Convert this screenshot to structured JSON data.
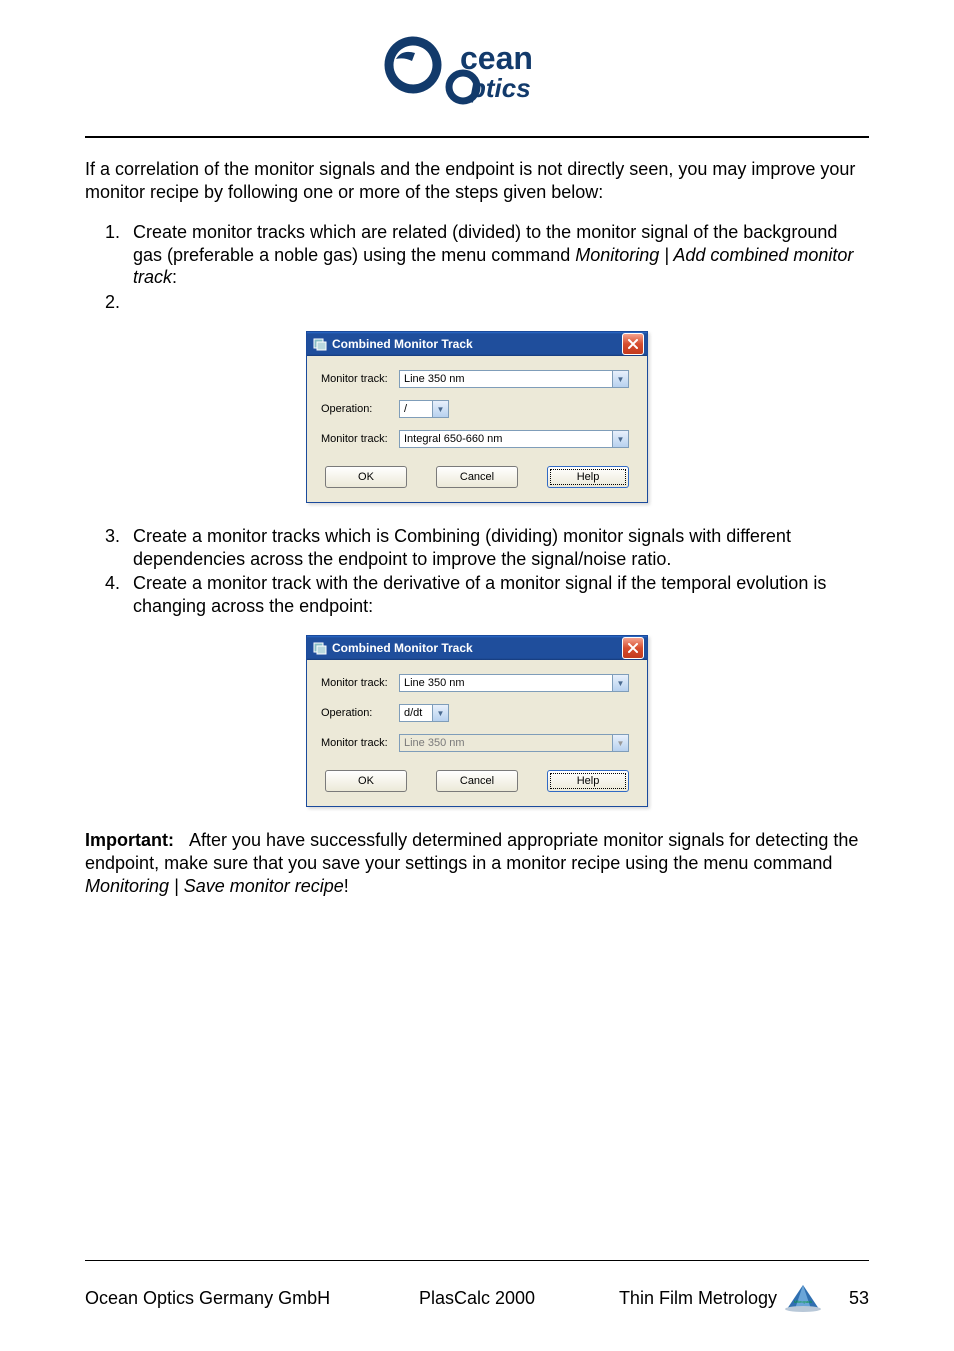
{
  "logo": {
    "top": "cean",
    "bottom": "ptics",
    "brand_blue": "#123a6b"
  },
  "para1": "If a correlation of the monitor signals and the endpoint is not directly seen, you may improve your monitor recipe by following one or more of the steps given below:",
  "list": {
    "item1_a": "Create monitor tracks which are related (divided) to the monitor signal of the background gas (preferable a noble gas) using the menu command ",
    "item1_b": "Monitoring | Add combined monitor track",
    "item1_c": ":",
    "item3": "Create a monitor tracks which is Combining (dividing) monitor signals with different dependencies across the endpoint to improve the signal/noise ratio.",
    "item4": "Create a monitor track with the derivative of a monitor signal if the temporal evolution is changing across the endpoint:"
  },
  "dialog1": {
    "title": "Combined Monitor Track",
    "labels": {
      "track1": "Monitor track:",
      "operation": "Operation:",
      "track2": "Monitor track:"
    },
    "values": {
      "track1": "Line 350 nm",
      "operation": "/",
      "track2": "Integral 650-660 nm"
    },
    "buttons": {
      "ok": "OK",
      "cancel": "Cancel",
      "help": "Help"
    }
  },
  "dialog2": {
    "title": "Combined Monitor Track",
    "labels": {
      "track1": "Monitor track:",
      "operation": "Operation:",
      "track2": "Monitor track:"
    },
    "values": {
      "track1": "Line 350 nm",
      "operation": "d/dt",
      "track2": "Line 350 nm"
    },
    "buttons": {
      "ok": "OK",
      "cancel": "Cancel",
      "help": "Help"
    }
  },
  "important": {
    "label": "Important:",
    "text_a": "After you have successfully determined appropriate monitor signals for detecting the endpoint, make sure that you save your settings in a monitor recipe using the menu command ",
    "text_b": "Monitoring | Save monitor recipe",
    "text_c": "!"
  },
  "footer": {
    "left": "Ocean Optics Germany GmbH",
    "center": "PlasCalc 2000",
    "right": "Thin Film Metrology",
    "page": "53"
  }
}
